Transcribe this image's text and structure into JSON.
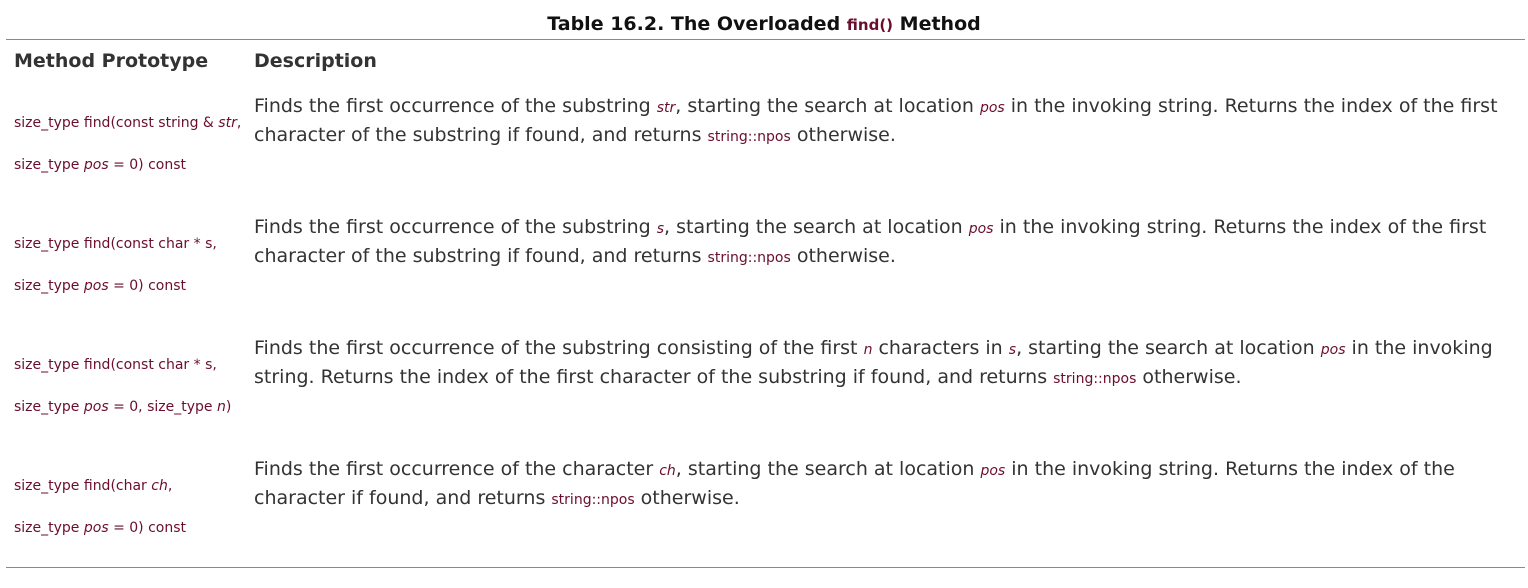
{
  "caption": {
    "prefix": "Table 16.2. The Overloaded",
    "code": "find()",
    "suffix": "Method"
  },
  "table": {
    "headers": {
      "prototype": "Method Prototype",
      "description": "Description"
    },
    "rows": [
      {
        "proto_line1": [
          {
            "t": "size_type find(const string & ",
            "it": false
          },
          {
            "t": "str",
            "it": true
          },
          {
            "t": ",",
            "it": false
          }
        ],
        "proto_line2": [
          {
            "t": "size_type ",
            "it": false
          },
          {
            "t": "pos",
            "it": true
          },
          {
            "t": " = 0) const",
            "it": false
          }
        ],
        "desc": [
          {
            "t": "Finds the first occurrence of the substring ",
            "k": "text"
          },
          {
            "t": "str",
            "k": "var"
          },
          {
            "t": ", starting the search at location ",
            "k": "text"
          },
          {
            "t": "pos",
            "k": "var"
          },
          {
            "t": " in the invoking string. Returns the index of the first character of the substring if found, and returns ",
            "k": "text"
          },
          {
            "t": "string::npos",
            "k": "code"
          },
          {
            "t": " otherwise.",
            "k": "text"
          }
        ]
      },
      {
        "proto_line1": [
          {
            "t": "size_type find(const char * s,",
            "it": false
          }
        ],
        "proto_line2": [
          {
            "t": "size_type ",
            "it": false
          },
          {
            "t": "pos",
            "it": true
          },
          {
            "t": " = 0) const",
            "it": false
          }
        ],
        "desc": [
          {
            "t": "Finds the first occurrence of the substring ",
            "k": "text"
          },
          {
            "t": "s",
            "k": "var"
          },
          {
            "t": ", starting the search at location ",
            "k": "text"
          },
          {
            "t": "pos",
            "k": "var"
          },
          {
            "t": " in the invoking string. Returns the index of the first character of the substring if found, and returns ",
            "k": "text"
          },
          {
            "t": "string::npos",
            "k": "code"
          },
          {
            "t": " otherwise.",
            "k": "text"
          }
        ]
      },
      {
        "proto_line1": [
          {
            "t": "size_type find(const char * s,",
            "it": false
          }
        ],
        "proto_line2": [
          {
            "t": "size_type ",
            "it": false
          },
          {
            "t": "pos",
            "it": true
          },
          {
            "t": " = 0, size_type ",
            "it": false
          },
          {
            "t": "n",
            "it": true
          },
          {
            "t": ")",
            "it": false
          }
        ],
        "desc": [
          {
            "t": "Finds the first occurrence of the substring consisting of the first ",
            "k": "text"
          },
          {
            "t": "n",
            "k": "var"
          },
          {
            "t": " characters in ",
            "k": "text"
          },
          {
            "t": "s",
            "k": "var"
          },
          {
            "t": ", starting the search at location ",
            "k": "text"
          },
          {
            "t": "pos",
            "k": "var"
          },
          {
            "t": " in the invoking string. Returns the index of the first character of the substring if found, and returns ",
            "k": "text"
          },
          {
            "t": "string::npos",
            "k": "code"
          },
          {
            "t": " otherwise.",
            "k": "text"
          }
        ]
      },
      {
        "proto_line1": [
          {
            "t": "size_type find(char ",
            "it": false
          },
          {
            "t": "ch",
            "it": true
          },
          {
            "t": ",",
            "it": false
          }
        ],
        "proto_line2": [
          {
            "t": "size_type ",
            "it": false
          },
          {
            "t": "pos",
            "it": true
          },
          {
            "t": " = 0) const",
            "it": false
          }
        ],
        "desc": [
          {
            "t": "Finds the first occurrence of the character ",
            "k": "text"
          },
          {
            "t": "ch",
            "k": "var"
          },
          {
            "t": ", starting the search at location ",
            "k": "text"
          },
          {
            "t": "pos",
            "k": "var"
          },
          {
            "t": " in the invoking string. Returns the index of the character if found, and returns ",
            "k": "text"
          },
          {
            "t": "string::npos",
            "k": "code"
          },
          {
            "t": " otherwise.",
            "k": "text"
          }
        ]
      }
    ]
  },
  "colors": {
    "code": "#6b0d2e",
    "text": "#333333",
    "rule": "#8a8a8a"
  }
}
